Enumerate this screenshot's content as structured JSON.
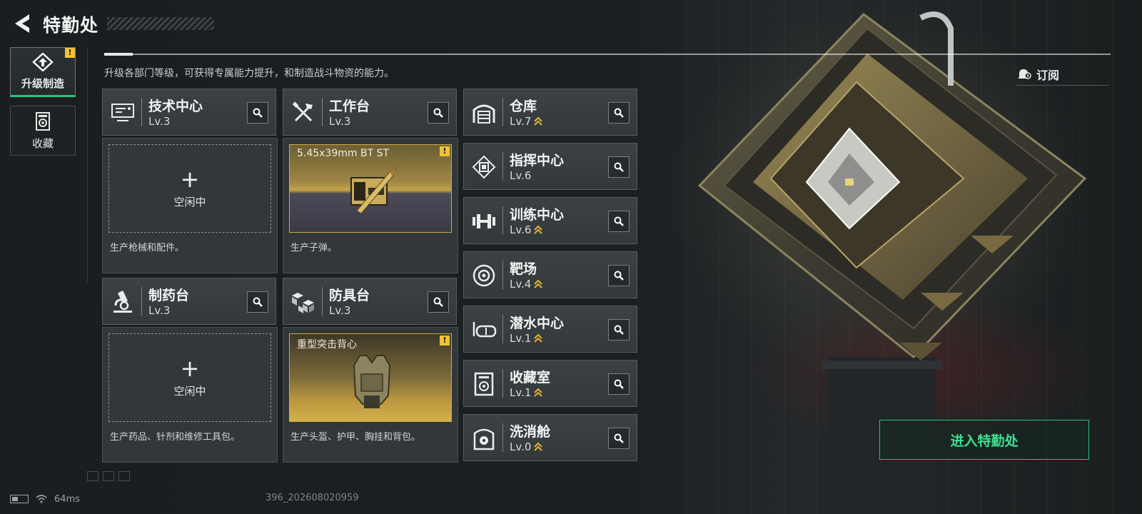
{
  "header": {
    "title": "特勤处",
    "subtitle": "升级各部门等级，可获得专属能力提升，和制造战斗物资的能力。",
    "subscribe_label": "订阅"
  },
  "side_tabs": [
    {
      "label": "升级制造",
      "active": true,
      "icon": "upgrade-icon",
      "warning": "!"
    },
    {
      "label": "收藏",
      "active": false,
      "icon": "collection-icon"
    }
  ],
  "production_cards": [
    {
      "name": "技术中心",
      "level": "Lv.3",
      "icon": "monitor-icon",
      "slot_status": "空闲中",
      "description": "生产枪械和配件。"
    },
    {
      "name": "工作台",
      "level": "Lv.3",
      "icon": "tools-icon",
      "product": "5.45x39mm BT ST",
      "description": "生产子弹。"
    },
    {
      "name": "制药台",
      "level": "Lv.3",
      "icon": "microscope-icon",
      "slot_status": "空闲中",
      "description": "生产药品、针剂和维修工具包。"
    },
    {
      "name": "防具台",
      "level": "Lv.3",
      "icon": "cubes-icon",
      "product": "重型突击背心",
      "description": "生产头盔、护甲、胸挂和背包。"
    }
  ],
  "departments": [
    {
      "name": "仓库",
      "level": "Lv.7",
      "icon": "warehouse-icon",
      "upgradable": true
    },
    {
      "name": "指挥中心",
      "level": "Lv.6",
      "icon": "command-chip-icon",
      "upgradable": false
    },
    {
      "name": "训练中心",
      "level": "Lv.6",
      "icon": "dumbbell-icon",
      "upgradable": true
    },
    {
      "name": "靶场",
      "level": "Lv.4",
      "icon": "target-icon",
      "upgradable": true
    },
    {
      "name": "潜水中心",
      "level": "Lv.1",
      "icon": "diving-mask-icon",
      "upgradable": true
    },
    {
      "name": "收藏室",
      "level": "Lv.1",
      "icon": "vault-icon",
      "upgradable": true
    },
    {
      "name": "洗消舱",
      "level": "Lv.0",
      "icon": "biohazard-booth-icon",
      "upgradable": true
    }
  ],
  "warning_mark": "!",
  "enter_button": "进入特勤处",
  "status_bar": {
    "ping": "64ms",
    "version": "396_202608020959"
  },
  "colors": {
    "accent": "#27c27a",
    "warning": "#f2c230",
    "upgrade_arrow": "#e3b431",
    "product_border": "#d0ab3c"
  }
}
